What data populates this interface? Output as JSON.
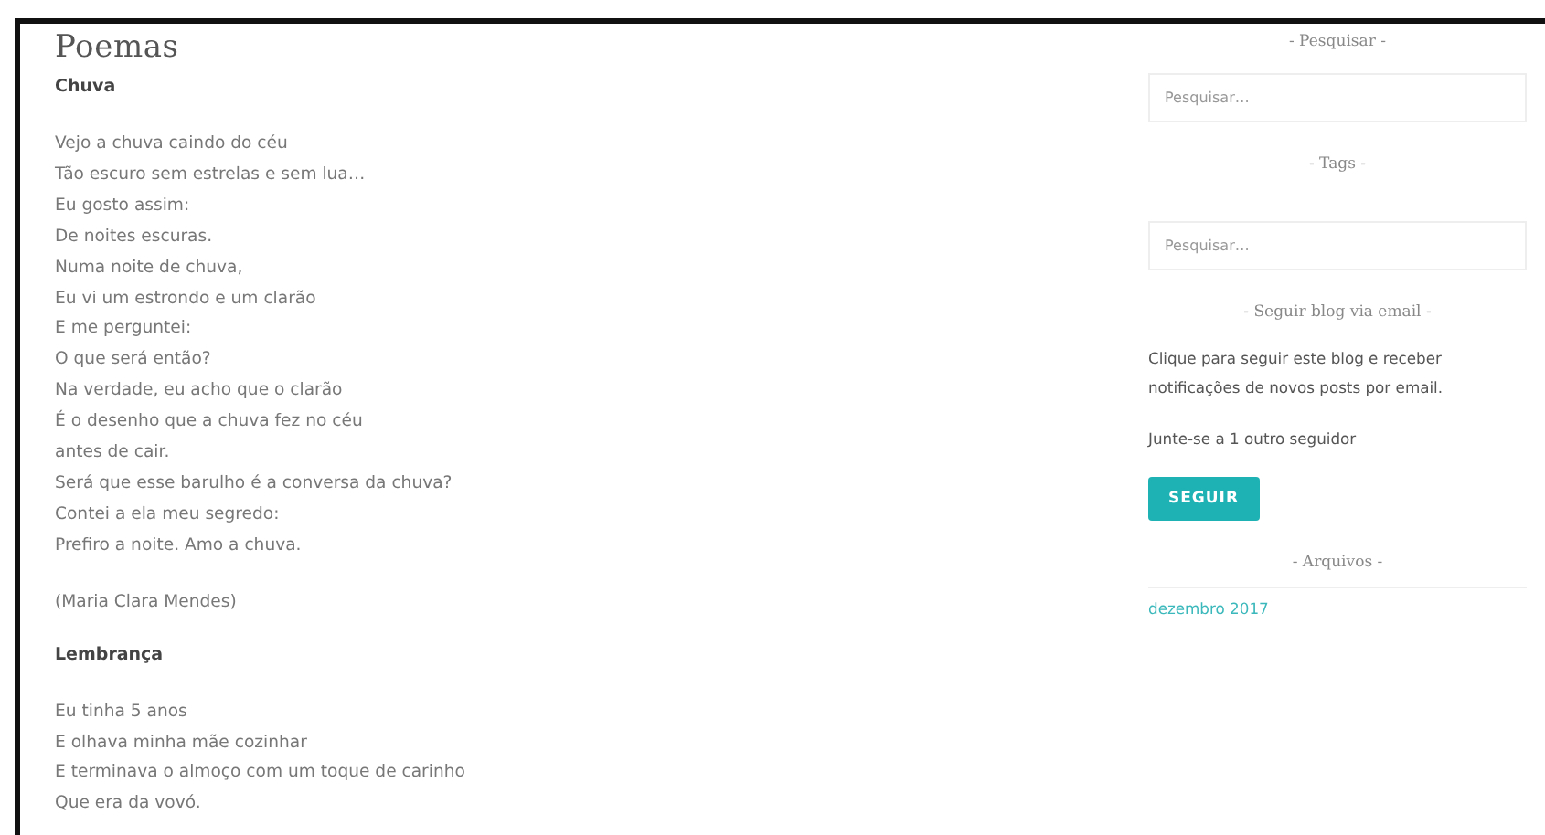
{
  "page": {
    "title": "Poemas"
  },
  "poems": [
    {
      "title": "Chuva",
      "lines": [
        "Vejo a chuva caindo do céu",
        "Tão escuro sem estrelas e sem lua…",
        "Eu gosto assim:",
        "De noites escuras.",
        "Numa noite de chuva,",
        "Eu vi um estrondo e um clarão",
        "E me perguntei:",
        "O que será então?",
        "Na verdade, eu acho que o clarão",
        "É o desenho que a chuva fez no céu",
        "antes de cair.",
        "Será que esse barulho é a conversa da chuva?",
        "Contei a ela meu segredo:",
        "Prefiro a noite. Amo a chuva."
      ],
      "author": "(Maria Clara Mendes)"
    },
    {
      "title": "Lembrança",
      "lines": [
        "Eu tinha 5 anos",
        "E olhava minha mãe cozinhar",
        "E terminava o almoço com um toque de carinho",
        "Que era da vovó."
      ]
    }
  ],
  "sidebar": [
    {
      "kind": "search",
      "heading": "- Pesquisar -",
      "placeholder": "Pesquisar…"
    },
    {
      "kind": "search",
      "heading": "- Tags -",
      "placeholder": "Pesquisar…"
    },
    {
      "kind": "follow",
      "heading": "- Seguir blog via email -",
      "text": "Clique para seguir este blog e receber notificações de novos posts por email.",
      "count": "Junte-se a 1 outro seguidor",
      "button": "SEGUIR"
    },
    {
      "kind": "links",
      "heading": "- Arquivos -",
      "links": [
        "dezembro 2017"
      ]
    }
  ]
}
